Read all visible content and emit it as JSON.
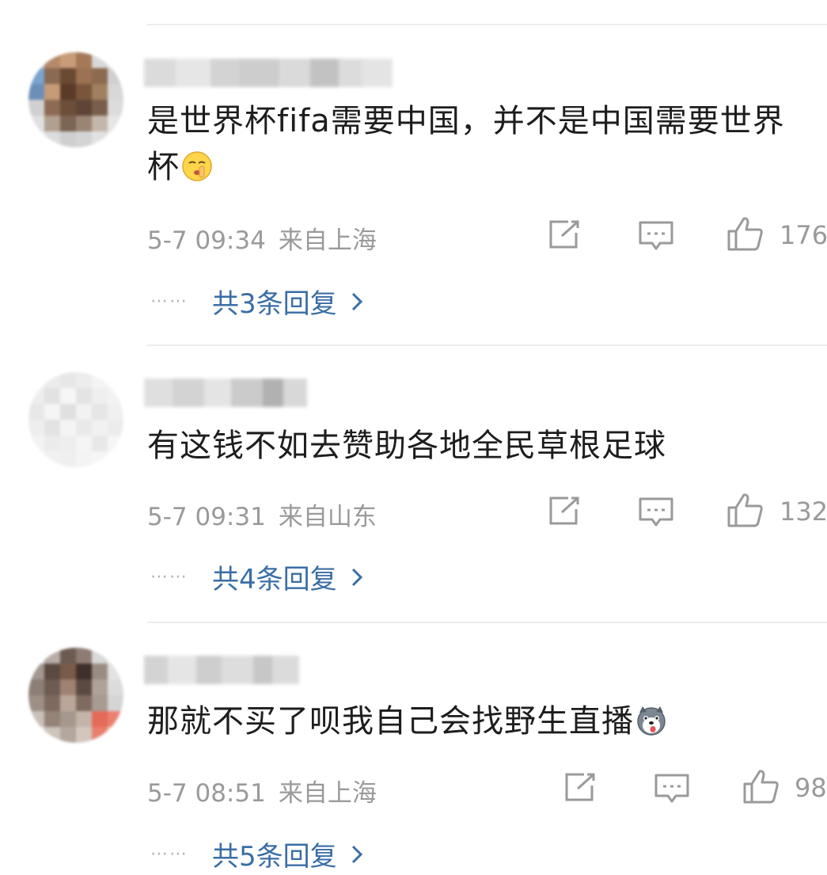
{
  "comments": [
    {
      "text": "是世界杯fifa需要中国，并不是中国需要世界杯",
      "emoji": "shush-face-emoji",
      "time": "5-7 09:34",
      "location": "来自上海",
      "likes": "176",
      "replies_label": "共3条回复",
      "dots": "⋯⋯"
    },
    {
      "text": "有这钱不如去赞助各地全民草根足球",
      "time": "5-7 09:31",
      "location": "来自山东",
      "likes": "132",
      "replies_label": "共4条回复",
      "dots": "⋯⋯"
    },
    {
      "text": "那就不买了呗我自己会找野生直播",
      "emoji": "husky-dog-emoji",
      "time": "5-7 08:51",
      "location": "来自上海",
      "likes": "98",
      "replies_label": "共5条回复",
      "dots": "⋯⋯"
    }
  ],
  "colors": {
    "link": "#3a6ea5",
    "meta": "#9a9a9a",
    "divider": "#ececec"
  }
}
